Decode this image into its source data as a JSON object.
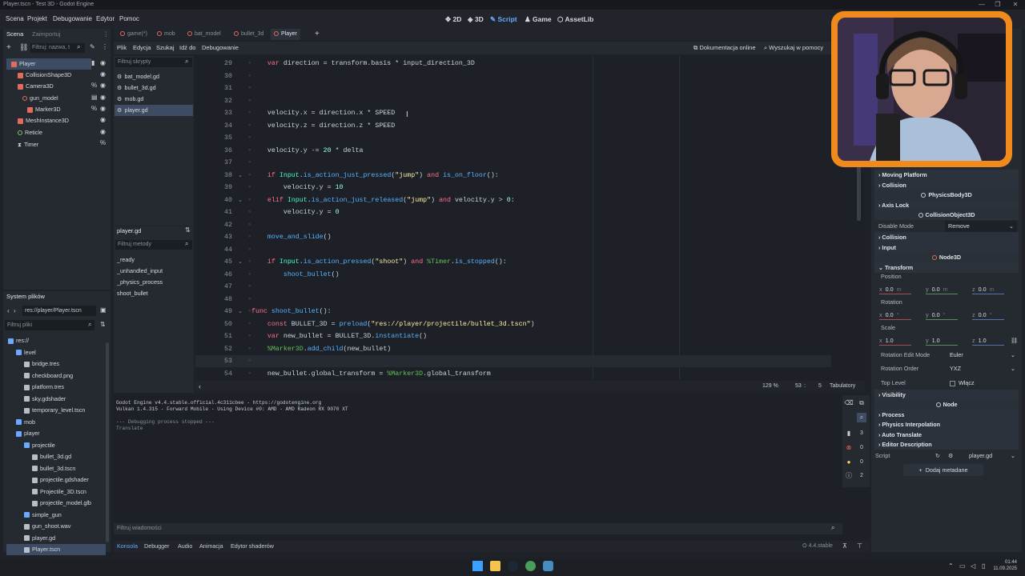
{
  "window": {
    "title": "Player.tscn - Test 3D - Godot Engine",
    "min": "—",
    "max": "❐",
    "close": "✕"
  },
  "menu": [
    "Scena",
    "Projekt",
    "Debugowanie",
    "Edytor",
    "Pomoc"
  ],
  "workspaces": {
    "w2d": "2D",
    "w3d": "3D",
    "script": "Script",
    "game": "Game",
    "assetlib": "AssetLib"
  },
  "scene_dock": {
    "tabs": [
      "Scena",
      "Zaimportuj"
    ],
    "filter_placeholder": "Filtruj: nazwa, t",
    "nodes": [
      {
        "label": "Player",
        "color": "#e26b5b",
        "selected": true
      },
      {
        "label": "CollisionShape3D",
        "color": "#e26b5b"
      },
      {
        "label": "Camera3D",
        "color": "#e26b5b"
      },
      {
        "label": "gun_model",
        "color": "#e26b5b"
      },
      {
        "label": "Marker3D",
        "color": "#e26b5b"
      },
      {
        "label": "MeshInstance3D",
        "color": "#e26b5b"
      },
      {
        "label": "Reticle",
        "color": "#7fc36a"
      },
      {
        "label": "Timer",
        "color": "#e0e3e8"
      }
    ]
  },
  "fs_dock": {
    "title": "System plików",
    "path": "res://player/Player.tscn",
    "filter_placeholder": "Filtruj pliki",
    "items": [
      {
        "label": "res://",
        "depth": 0
      },
      {
        "label": "level",
        "depth": 1
      },
      {
        "label": "bridge.tres",
        "depth": 2
      },
      {
        "label": "checkboard.png",
        "depth": 2
      },
      {
        "label": "platform.tres",
        "depth": 2
      },
      {
        "label": "sky.gdshader",
        "depth": 2
      },
      {
        "label": "temporary_level.tscn",
        "depth": 2
      },
      {
        "label": "mob",
        "depth": 1
      },
      {
        "label": "player",
        "depth": 1
      },
      {
        "label": "projectile",
        "depth": 2
      },
      {
        "label": "bullet_3d.gd",
        "depth": 3
      },
      {
        "label": "bullet_3d.tscn",
        "depth": 3
      },
      {
        "label": "projectile.gdshader",
        "depth": 3
      },
      {
        "label": "Projectile_3D.tscn",
        "depth": 3
      },
      {
        "label": "projectile_model.glb",
        "depth": 3
      },
      {
        "label": "simple_gun",
        "depth": 2
      },
      {
        "label": "gun_shoot.wav",
        "depth": 2
      },
      {
        "label": "player.gd",
        "depth": 2
      },
      {
        "label": "Player.tscn",
        "depth": 2,
        "selected": true
      }
    ]
  },
  "scene_tabs": [
    "game(*)",
    "mob",
    "bat_model",
    "bullet_3d",
    "Player"
  ],
  "script_menu": [
    "Plik",
    "Edycja",
    "Szukaj",
    "Idź do",
    "Debugowanie"
  ],
  "script_links": {
    "docs": "Dokumentacja online",
    "search": "Wyszukaj w pomocy"
  },
  "script_list": {
    "filter_placeholder": "Filtruj skrypty",
    "scripts": [
      "bat_model.gd",
      "bullet_3d.gd",
      "mob.gd",
      "player.gd"
    ],
    "current": "player.gd",
    "methods_filter": "Filtruj metody",
    "methods": [
      "_ready",
      "_unhandled_input",
      "_physics_process",
      "shoot_bullet"
    ]
  },
  "code_lines": [
    {
      "n": "29",
      "html": "    <span class='kw'>var</span> direction = transform.basis * input_direction_3D"
    },
    {
      "n": "30",
      "html": ""
    },
    {
      "n": "31",
      "html": ""
    },
    {
      "n": "32",
      "html": ""
    },
    {
      "n": "33",
      "html": "    velocity.x = direction.x * SPEED"
    },
    {
      "n": "34",
      "html": "    velocity.z = direction.z * SPEED"
    },
    {
      "n": "35",
      "html": ""
    },
    {
      "n": "36",
      "html": "    velocity.y -= <span class='nu'>20</span> * delta"
    },
    {
      "n": "37",
      "html": ""
    },
    {
      "n": "38",
      "html": "    <span class='kw'>if</span> <span class='bi'>Input</span>.<span class='fn'>is_action_just_pressed</span>(<span class='st'>\"jump\"</span>) <span class='kw'>and</span> <span class='fn'>is_on_floor</span>():"
    },
    {
      "n": "39",
      "html": "        velocity.y = <span class='nu'>10</span>"
    },
    {
      "n": "40",
      "html": "    <span class='kw'>elif</span> <span class='bi'>Input</span>.<span class='fn'>is_action_just_released</span>(<span class='st'>\"jump\"</span>) <span class='kw'>and</span> velocity.y &gt; <span class='nu'>0</span>:"
    },
    {
      "n": "41",
      "html": "        velocity.y = <span class='nu'>0</span>"
    },
    {
      "n": "42",
      "html": ""
    },
    {
      "n": "43",
      "html": "    <span class='fn'>move_and_slide</span>()"
    },
    {
      "n": "44",
      "html": ""
    },
    {
      "n": "45",
      "html": "    <span class='kw'>if</span> <span class='bi'>Input</span>.<span class='fn'>is_action_pressed</span>(<span class='st'>\"shoot\"</span>) <span class='kw'>and</span> <span class='np'>%Timer</span>.<span class='fn'>is_stopped</span>():"
    },
    {
      "n": "46",
      "html": "        <span class='fn'>shoot_bullet</span>()"
    },
    {
      "n": "47",
      "html": ""
    },
    {
      "n": "48",
      "html": ""
    },
    {
      "n": "49",
      "html": "<span class='kw'>func</span> <span class='fn'>shoot_bullet</span>():"
    },
    {
      "n": "50",
      "html": "    <span class='kw'>const</span> BULLET_3D = <span class='fn'>preload</span>(<span class='st'>\"res://player/projectile/bullet_3d.tscn\"</span>)"
    },
    {
      "n": "51",
      "html": "    <span class='kw'>var</span> new_bullet = BULLET_3D.<span class='fn'>instantiate</span>()"
    },
    {
      "n": "52",
      "html": "    <span class='np'>%Marker3D</span>.<span class='fn'>add_child</span>(new_bullet)"
    },
    {
      "n": "53",
      "html": ""
    },
    {
      "n": "54",
      "html": "    new_bullet.global_transform = <span class='np'>%Marker3D</span>.global_transform"
    }
  ],
  "editor_status": {
    "zoom": "129 %",
    "line": "53",
    "col": "5",
    "indent": "Tabulatory"
  },
  "output": {
    "lines": [
      "Godot Engine v4.4.stable.official.4c311cbee - https://godotengine.org",
      "Vulkan 1.4.315 - Forward Mobile - Using Device #0: AMD - AMD Radeon RX 9070 XT",
      "",
      "--- Debugging process stopped ---",
      "Translate"
    ],
    "filter_placeholder": "Filtruj wiadomości",
    "counts": {
      "messages": "3",
      "errors": "0",
      "warnings": "0",
      "other": "2"
    }
  },
  "bottom_tabs": [
    "Konsola",
    "Debugger",
    "Audio",
    "Animacja",
    "Edytor shaderów"
  ],
  "version": "4.4.stable",
  "inspector": {
    "sections": [
      "Moving Platform",
      "Collision"
    ],
    "class_physicsbody": "PhysicsBody3D",
    "axis_lock": "Axis Lock",
    "class_collisionobject": "CollisionObject3D",
    "disable_mode_label": "Disable Mode",
    "disable_mode_value": "Remove",
    "collision": "Collision",
    "input": "Input",
    "class_node3d": "Node3D",
    "transform": "Transform",
    "position_label": "Position",
    "position": {
      "x": "0.0",
      "y": "0.0",
      "z": "0.0",
      "unit": "m"
    },
    "rotation_label": "Rotation",
    "rotation": {
      "x": "0.0",
      "y": "0.0",
      "z": "0.0",
      "unit": "°"
    },
    "scale_label": "Scale",
    "scale": {
      "x": "1.0",
      "y": "1.0",
      "z": "1.0"
    },
    "rot_edit_label": "Rotation Edit Mode",
    "rot_edit_value": "Euler",
    "rot_order_label": "Rotation Order",
    "rot_order_value": "YXZ",
    "top_level_label": "Top Level",
    "top_level_value": "Włącz",
    "visibility": "Visibility",
    "class_node": "Node",
    "process": "Process",
    "physics_interp": "Physics Interpolation",
    "auto_translate": "Auto Translate",
    "editor_desc": "Editor Description",
    "script_label": "Script",
    "script_value": "player.gd",
    "add_meta": "Dodaj metadane"
  },
  "taskbar": {
    "time": "01:44",
    "date": "11.09.2025"
  },
  "colors": {
    "accent": "#6aa9ff",
    "webcam_border": "#f08a1d"
  }
}
